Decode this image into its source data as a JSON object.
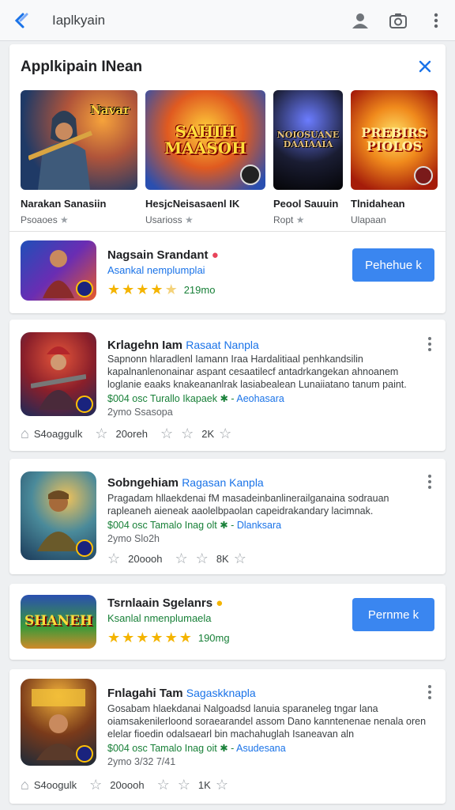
{
  "topbar": {
    "query": "Iaplkyain"
  },
  "featured": {
    "title": "Applkipain INean",
    "games": [
      {
        "name": "Narakan Sanasiin",
        "sub": "Psoaoes",
        "art": "Navar"
      },
      {
        "name": "HesjcNeisasaenl IK",
        "sub": "Usarioss",
        "art": "SAHIH MAASOH"
      },
      {
        "name": "Peool Sauuin",
        "sub": "Ropt",
        "art": "NOIOSUANE DAAIAAIA"
      },
      {
        "name": "Tlnidahean",
        "sub": "Ulapaan",
        "art": "PREBIRS PIOLOS"
      }
    ]
  },
  "row1": {
    "title": "Nagsain Srandant",
    "sub": "Asankal nemplumplai",
    "rating": "219mo",
    "button": "Pehehue k"
  },
  "row2": {
    "title": "Krlagehn Iam",
    "title_link": "Rasaat Nanpla",
    "desc": "Sapnonn hlaradlenl Iamann Iraa Hardalitiaal penhkandsilin kapalnanlenonainar aspant cesaatilecf antadrkangekan ahnoanem loglanie eaaks knakeananlrak lasiabealean Lunaiiatano tanum paint.",
    "meta": "$004 osc Turallo Ikapaek ✱ -",
    "publisher": "Aeohasara",
    "size": "2ymo Ssasopa",
    "stats": [
      "S4oaggulk",
      "20oreh",
      "2K"
    ]
  },
  "row3": {
    "title": "Sobngehiam",
    "title_link": "Ragasan Kanpla",
    "desc": "Pragadam hllaekdenai fM masadeinbanlinerailganaina sodrauan rapleaneh aieneak aaolelbpaolan capeidrakandary lacimnak.",
    "meta": "$004 osc Tamalo Inag olt ✱ -",
    "publisher": "Dlanksara",
    "size": "2ymo Slo2h",
    "stats": [
      "20oooh",
      "8K"
    ]
  },
  "row4": {
    "title": "Tsrnlaain Sgelanrs",
    "sub": "Ksanlal nmenplumaela",
    "rating": "190mg",
    "button": "Pernme k",
    "art": "SHANEH"
  },
  "row5": {
    "title": "Fnlagahi Tam",
    "title_link": "Sagaskknapla",
    "desc": "Gosabam hlaekdanai Nalgoadsd lanuia sparaneleg tngar lana oiamsakenilerloond soraearandel assom Dano kanntenenae nenala oren elelar fioedin odalsaearl bin machahuglah Isaneavan aln",
    "meta": "$004 osc Tamalo Inag oit ✱ -",
    "publisher": "Asudesana",
    "size": "2ymo 3/32 7/41",
    "stats": [
      "S4oogulk",
      "20oooh",
      "1K"
    ]
  },
  "colors": {
    "accent": "#1a73e8",
    "install": "#3a86f0",
    "star": "#f4b400",
    "green": "#188038"
  }
}
